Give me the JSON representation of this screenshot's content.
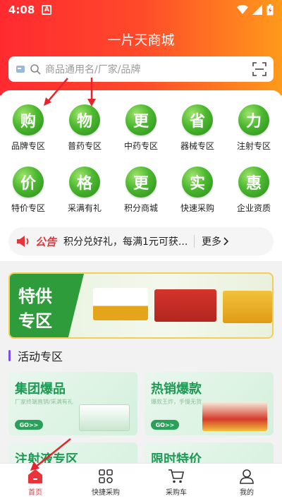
{
  "status_bar": {
    "time": "4:08",
    "notif_glyph": "A"
  },
  "header": {
    "title": "一片天商城"
  },
  "search": {
    "placeholder": "商品通用名/厂家/品牌"
  },
  "categories": [
    {
      "glyph": "购",
      "label": "品牌专区"
    },
    {
      "glyph": "物",
      "label": "普药专区"
    },
    {
      "glyph": "更",
      "label": "中药专区"
    },
    {
      "glyph": "省",
      "label": "器械专区"
    },
    {
      "glyph": "力",
      "label": "注射专区"
    },
    {
      "glyph": "价",
      "label": "特价专区"
    },
    {
      "glyph": "格",
      "label": "采满有礼"
    },
    {
      "glyph": "更",
      "label": "积分商城"
    },
    {
      "glyph": "实",
      "label": "快速采购"
    },
    {
      "glyph": "惠",
      "label": "企业资质"
    }
  ],
  "notice": {
    "tag": "公告",
    "text": "积分兑好礼，每满1元可获...",
    "more": "更多"
  },
  "banner": {
    "line1": "特供",
    "line2": "专区"
  },
  "activity": {
    "title": "活动专区",
    "cards": [
      {
        "title": "集团爆品",
        "subtitle": "厂家终端直销/采满有礼",
        "go": "GO>>"
      },
      {
        "title": "热销爆款",
        "subtitle": "爆款王炸，手慢无货",
        "go": "GO>>"
      },
      {
        "title": "注射液专区"
      },
      {
        "title": "限时特价"
      }
    ]
  },
  "tabbar": [
    {
      "label": "首页",
      "icon": "home-icon",
      "active": true
    },
    {
      "label": "快捷采购",
      "icon": "grid-icon",
      "active": false
    },
    {
      "label": "采购车",
      "icon": "cart-icon",
      "active": false
    },
    {
      "label": "我的",
      "icon": "user-icon",
      "active": false
    }
  ],
  "colors": {
    "brand_red": "#ff2a30",
    "brand_orange": "#ff9a1a",
    "green": "#2f9c3b",
    "accent": "#e8333a"
  }
}
